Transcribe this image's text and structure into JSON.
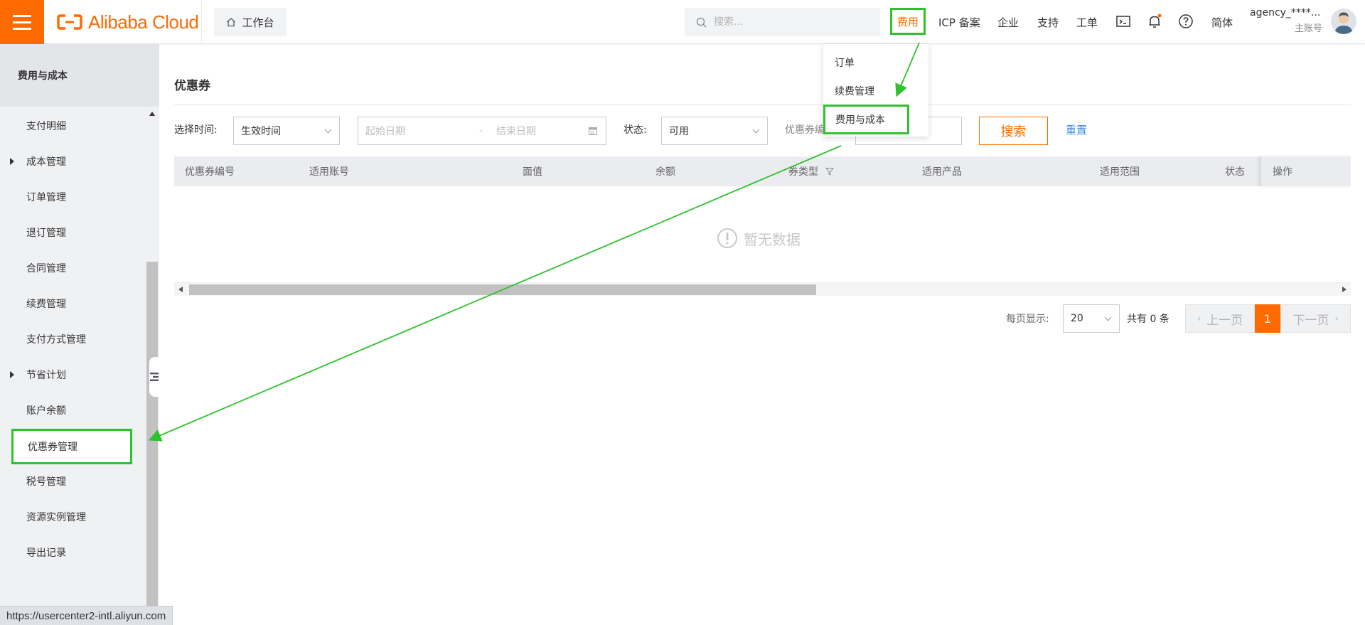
{
  "topbar": {
    "logo_text": "Alibaba Cloud",
    "workbench_label": "工作台",
    "search_placeholder": "搜索...",
    "nav": {
      "fee": "费用",
      "icp": "ICP 备案",
      "enterprise": "企业",
      "support": "支持",
      "ticket": "工单",
      "language": "简体"
    },
    "account_name": "agency_****...",
    "account_type": "主账号",
    "brand_color": "#ff6a00"
  },
  "dropdown": {
    "items": [
      "订单",
      "续费管理",
      "费用与成本"
    ]
  },
  "sidebar": {
    "title": "费用与成本",
    "items": [
      {
        "label": "支付明细",
        "has_children": false
      },
      {
        "label": "成本管理",
        "has_children": true
      },
      {
        "label": "订单管理",
        "has_children": false
      },
      {
        "label": "退订管理",
        "has_children": false
      },
      {
        "label": "合同管理",
        "has_children": false
      },
      {
        "label": "续费管理",
        "has_children": false
      },
      {
        "label": "支付方式管理",
        "has_children": false
      },
      {
        "label": "节省计划",
        "has_children": true
      },
      {
        "label": "账户余额",
        "has_children": false
      },
      {
        "label": "优惠券管理",
        "has_children": false,
        "active": true
      },
      {
        "label": "税号管理",
        "has_children": false
      },
      {
        "label": "资源实例管理",
        "has_children": false
      },
      {
        "label": "导出记录",
        "has_children": false
      }
    ]
  },
  "main": {
    "title": "优惠券",
    "filters": {
      "time_label": "选择时间:",
      "time_value": "生效时间",
      "start_placeholder": "起始日期",
      "end_placeholder": "结束日期",
      "date_sep": "-",
      "status_label": "状态:",
      "status_value": "可用",
      "coupon_label": "优惠券编",
      "search_button": "搜索",
      "reset_link": "重置"
    },
    "table": {
      "columns": [
        "优惠券编号",
        "适用账号",
        "面值",
        "余额",
        "券类型",
        "适用产品",
        "适用范围",
        "状态",
        "操作"
      ],
      "rows": [],
      "empty_text": "暂无数据"
    },
    "pagination": {
      "page_size_label": "每页显示:",
      "page_size": "20",
      "total_text": "共有 0 条",
      "prev": "上一页",
      "next": "下一页",
      "current": "1"
    }
  },
  "statusbar": {
    "url": "https://usercenter2-intl.aliyun.com"
  },
  "annotation_color": "#2ec22e"
}
